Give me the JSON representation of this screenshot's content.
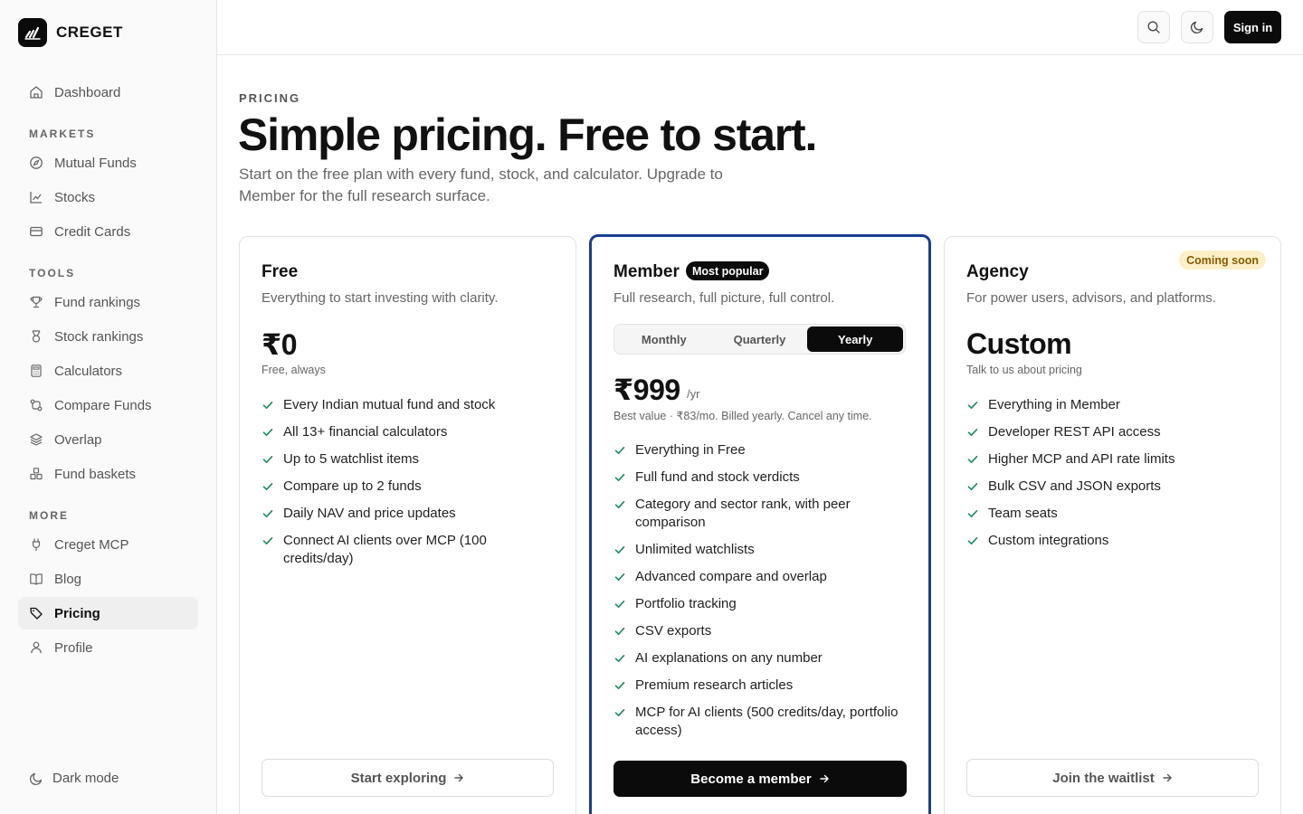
{
  "brand": {
    "name": "CREGET"
  },
  "sidebar": {
    "dashboard": "Dashboard",
    "markets_label": "MARKETS",
    "markets": [
      "Mutual Funds",
      "Stocks",
      "Credit Cards"
    ],
    "tools_label": "TOOLS",
    "tools": [
      "Fund rankings",
      "Stock rankings",
      "Calculators",
      "Compare Funds",
      "Overlap",
      "Fund baskets"
    ],
    "more_label": "MORE",
    "more": [
      "Creget MCP",
      "Blog",
      "Pricing",
      "Profile"
    ],
    "active_item": "Pricing",
    "dark_mode": "Dark mode"
  },
  "header": {
    "signin": "Sign in"
  },
  "page": {
    "eyebrow": "PRICING",
    "title": "Simple pricing. Free to start.",
    "subtitle": "Start on the free plan with every fund, stock, and calculator. Upgrade to Member for the full research surface."
  },
  "plans": {
    "free": {
      "name": "Free",
      "desc": "Everything to start investing with clarity.",
      "price": "₹0",
      "note": "Free, always",
      "features": [
        "Every Indian mutual fund and stock",
        "All 13+ financial calculators",
        "Up to 5 watchlist items",
        "Compare up to 2 funds",
        "Daily NAV and price updates",
        "Connect AI clients over MCP (100 credits/day)"
      ],
      "cta": "Start exploring"
    },
    "member": {
      "name": "Member",
      "badge": "Most popular",
      "desc": "Full research, full picture, full control.",
      "billing": [
        "Monthly",
        "Quarterly",
        "Yearly"
      ],
      "billing_selected": "Yearly",
      "price": "₹999",
      "period": "/yr",
      "note": "Best value · ₹83/mo. Billed yearly. Cancel any time.",
      "features": [
        "Everything in Free",
        "Full fund and stock verdicts",
        "Category and sector rank, with peer comparison",
        "Unlimited watchlists",
        "Advanced compare and overlap",
        "Portfolio tracking",
        "CSV exports",
        "AI explanations on any number",
        "Premium research articles",
        "MCP for AI clients (500 credits/day, portfolio access)"
      ],
      "cta": "Become a member"
    },
    "agency": {
      "name": "Agency",
      "badge": "Coming soon",
      "desc": "For power users, advisors, and platforms.",
      "price": "Custom",
      "note": "Talk to us about pricing",
      "features": [
        "Everything in Member",
        "Developer REST API access",
        "Higher MCP and API rate limits",
        "Bulk CSV and JSON exports",
        "Team seats",
        "Custom integrations"
      ],
      "cta": "Join the waitlist"
    }
  },
  "colors": {
    "accent_border": "#1a3f8f",
    "check": "#1a8a5a",
    "badge_soon_bg": "#fdf0c8"
  }
}
